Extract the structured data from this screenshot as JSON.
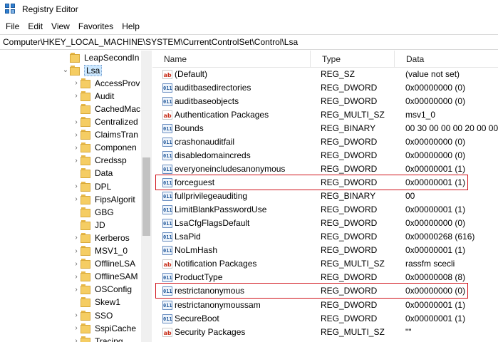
{
  "window": {
    "title": "Registry Editor"
  },
  "menu": [
    "File",
    "Edit",
    "View",
    "Favorites",
    "Help"
  ],
  "address": "Computer\\HKEY_LOCAL_MACHINE\\SYSTEM\\CurrentControlSet\\Control\\Lsa",
  "tree": {
    "items": [
      {
        "label": "LeapSecondInformation",
        "display": "LeapSecondIn",
        "expandable": false,
        "level": 0
      },
      {
        "label": "Lsa",
        "display": "Lsa",
        "expandable": true,
        "expanded": true,
        "selected": true,
        "level": 0
      },
      {
        "label": "AccessProviders",
        "display": "AccessProv",
        "expandable": true,
        "level": 1
      },
      {
        "label": "Audit",
        "display": "Audit",
        "expandable": true,
        "level": 1
      },
      {
        "label": "CachedMachineNames",
        "display": "CachedMac",
        "expandable": false,
        "level": 1
      },
      {
        "label": "CentralizedAccessPolicies",
        "display": "Centralized",
        "expandable": true,
        "level": 1
      },
      {
        "label": "ClaimsTransformation",
        "display": "ClaimsTran",
        "expandable": true,
        "level": 1
      },
      {
        "label": "ComponentUpdates",
        "display": "Componen",
        "expandable": true,
        "level": 1
      },
      {
        "label": "Credssp",
        "display": "Credssp",
        "expandable": true,
        "level": 1
      },
      {
        "label": "Data",
        "display": "Data",
        "expandable": false,
        "level": 1
      },
      {
        "label": "DPL",
        "display": "DPL",
        "expandable": true,
        "level": 1
      },
      {
        "label": "FipsAlgorithmPolicy",
        "display": "FipsAlgorit",
        "expandable": true,
        "level": 1
      },
      {
        "label": "GBG",
        "display": "GBG",
        "expandable": false,
        "level": 1
      },
      {
        "label": "JD",
        "display": "JD",
        "expandable": false,
        "level": 1
      },
      {
        "label": "Kerberos",
        "display": "Kerberos",
        "expandable": true,
        "level": 1
      },
      {
        "label": "MSV1_0",
        "display": "MSV1_0",
        "expandable": true,
        "level": 1
      },
      {
        "label": "OfflineLSA",
        "display": "OfflineLSA",
        "expandable": true,
        "level": 1
      },
      {
        "label": "OfflineSAM",
        "display": "OfflineSAM",
        "expandable": true,
        "level": 1
      },
      {
        "label": "OSConfig",
        "display": "OSConfig",
        "expandable": true,
        "level": 1
      },
      {
        "label": "Skew1",
        "display": "Skew1",
        "expandable": false,
        "level": 1
      },
      {
        "label": "SSO",
        "display": "SSO",
        "expandable": true,
        "level": 1
      },
      {
        "label": "SspiCache",
        "display": "SspiCache",
        "expandable": true,
        "level": 1
      },
      {
        "label": "Tracing",
        "display": "Tracing",
        "expandable": true,
        "level": 1
      }
    ]
  },
  "list": {
    "columns": [
      "Name",
      "Type",
      "Data"
    ],
    "rows": [
      {
        "name": "(Default)",
        "type": "REG_SZ",
        "data": "(value not set)",
        "icon": "string-value-icon"
      },
      {
        "name": "auditbasedirectories",
        "type": "REG_DWORD",
        "data": "0x00000000 (0)",
        "icon": "binary-value-icon"
      },
      {
        "name": "auditbaseobjects",
        "type": "REG_DWORD",
        "data": "0x00000000 (0)",
        "icon": "binary-value-icon"
      },
      {
        "name": "Authentication Packages",
        "type": "REG_MULTI_SZ",
        "data": "msv1_0",
        "icon": "string-value-icon"
      },
      {
        "name": "Bounds",
        "type": "REG_BINARY",
        "data": "00 30 00 00 00 20 00 00",
        "icon": "binary-value-icon"
      },
      {
        "name": "crashonauditfail",
        "type": "REG_DWORD",
        "data": "0x00000000 (0)",
        "icon": "binary-value-icon"
      },
      {
        "name": "disabledomaincreds",
        "type": "REG_DWORD",
        "data": "0x00000000 (0)",
        "icon": "binary-value-icon"
      },
      {
        "name": "everyoneincludesanonymous",
        "type": "REG_DWORD",
        "data": "0x00000001 (1)",
        "icon": "binary-value-icon"
      },
      {
        "name": "forceguest",
        "type": "REG_DWORD",
        "data": "0x00000001 (1)",
        "icon": "binary-value-icon",
        "highlighted": true
      },
      {
        "name": "fullprivilegeauditing",
        "type": "REG_BINARY",
        "data": "00",
        "icon": "binary-value-icon"
      },
      {
        "name": "LimitBlankPasswordUse",
        "type": "REG_DWORD",
        "data": "0x00000001 (1)",
        "icon": "binary-value-icon"
      },
      {
        "name": "LsaCfgFlagsDefault",
        "type": "REG_DWORD",
        "data": "0x00000000 (0)",
        "icon": "binary-value-icon"
      },
      {
        "name": "LsaPid",
        "type": "REG_DWORD",
        "data": "0x00000268 (616)",
        "icon": "binary-value-icon"
      },
      {
        "name": "NoLmHash",
        "type": "REG_DWORD",
        "data": "0x00000001 (1)",
        "icon": "binary-value-icon"
      },
      {
        "name": "Notification Packages",
        "type": "REG_MULTI_SZ",
        "data": "rassfm scecli",
        "icon": "string-value-icon"
      },
      {
        "name": "ProductType",
        "type": "REG_DWORD",
        "data": "0x00000008 (8)",
        "icon": "binary-value-icon"
      },
      {
        "name": "restrictanonymous",
        "type": "REG_DWORD",
        "data": "0x00000000 (0)",
        "icon": "binary-value-icon",
        "highlighted": true
      },
      {
        "name": "restrictanonymoussam",
        "type": "REG_DWORD",
        "data": "0x00000001 (1)",
        "icon": "binary-value-icon"
      },
      {
        "name": "SecureBoot",
        "type": "REG_DWORD",
        "data": "0x00000001 (1)",
        "icon": "binary-value-icon"
      },
      {
        "name": "Security Packages",
        "type": "REG_MULTI_SZ",
        "data": "\"\"",
        "icon": "string-value-icon"
      }
    ]
  },
  "colors": {
    "highlight": "#d0131b",
    "selection": "#cce8ff",
    "folder": "#f5cd63"
  }
}
